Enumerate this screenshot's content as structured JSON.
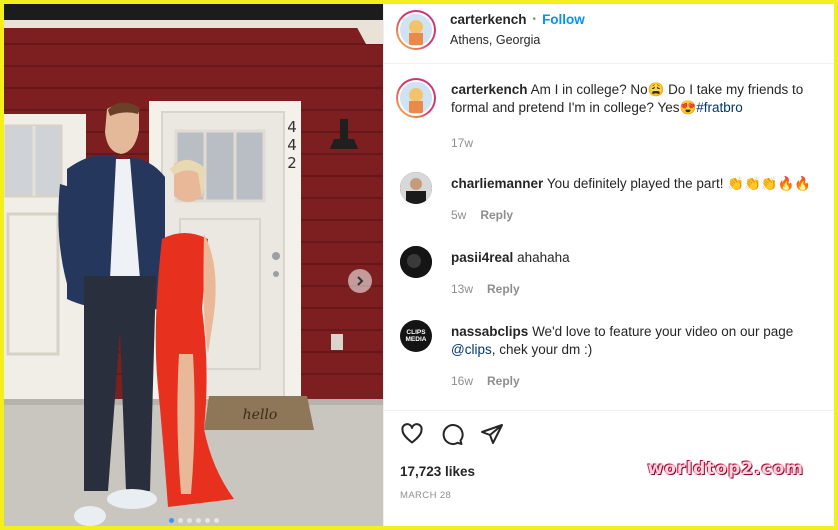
{
  "post": {
    "username": "carterkench",
    "separator": "•",
    "follow_label": "Follow",
    "location": "Athens, Georgia",
    "caption_text": "Am I in college? No😩 Do I take my friends to formal and pretend I'm in college? Yes😍",
    "caption_hashtag": "#fratbro",
    "caption_age": "17w",
    "likes": "17,723 likes",
    "date": "MARCH 28",
    "door_number": "442",
    "doormat_text": "hello"
  },
  "comments": [
    {
      "username": "charliemanner",
      "text": "You definitely played the part! 👏👏👏🔥🔥",
      "age": "5w",
      "reply_label": "Reply"
    },
    {
      "username": "pasii4real",
      "text": "ahahaha",
      "age": "13w",
      "reply_label": "Reply"
    },
    {
      "username": "nassabclips",
      "text_before": "We'd love to feature your video on our page",
      "mention": "@clips",
      "text_after": ", chek your dm :)",
      "age": "16w",
      "reply_label": "Reply",
      "avatar_text": "CLIPS MEDIA"
    }
  ],
  "watermark": "worldtop2.com",
  "colors": {
    "accent": "#0095f6",
    "frame": "#f3ef1a",
    "wall": "#7d1f21",
    "dress": "#e8301f"
  },
  "icons": {
    "like": "heart-icon",
    "comment": "comment-icon",
    "share": "paper-plane-icon",
    "next": "chevron-right-icon"
  }
}
